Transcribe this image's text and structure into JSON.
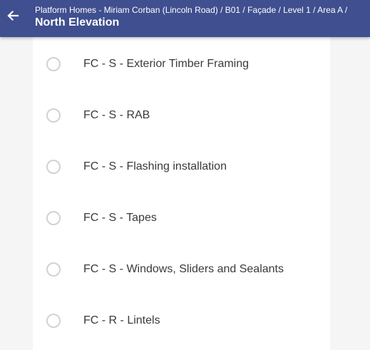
{
  "header": {
    "back_icon": "arrow-left-icon",
    "breadcrumb": "Platform Homes - Miriam Corban (Lincoln Road) / B01 / Façade / Level 1 / Area A /",
    "title": "North Elevation",
    "background_color": "#3f4f8f"
  },
  "options": [
    {
      "label": "FC - S - Exterior Timber Framing",
      "selected": false
    },
    {
      "label": "FC - S - RAB",
      "selected": false
    },
    {
      "label": "FC - S - Flashing installation",
      "selected": false
    },
    {
      "label": "FC - S - Tapes",
      "selected": false
    },
    {
      "label": "FC - S - Windows, Sliders and Sealants",
      "selected": false
    },
    {
      "label": "FC - R - Lintels",
      "selected": false
    }
  ]
}
